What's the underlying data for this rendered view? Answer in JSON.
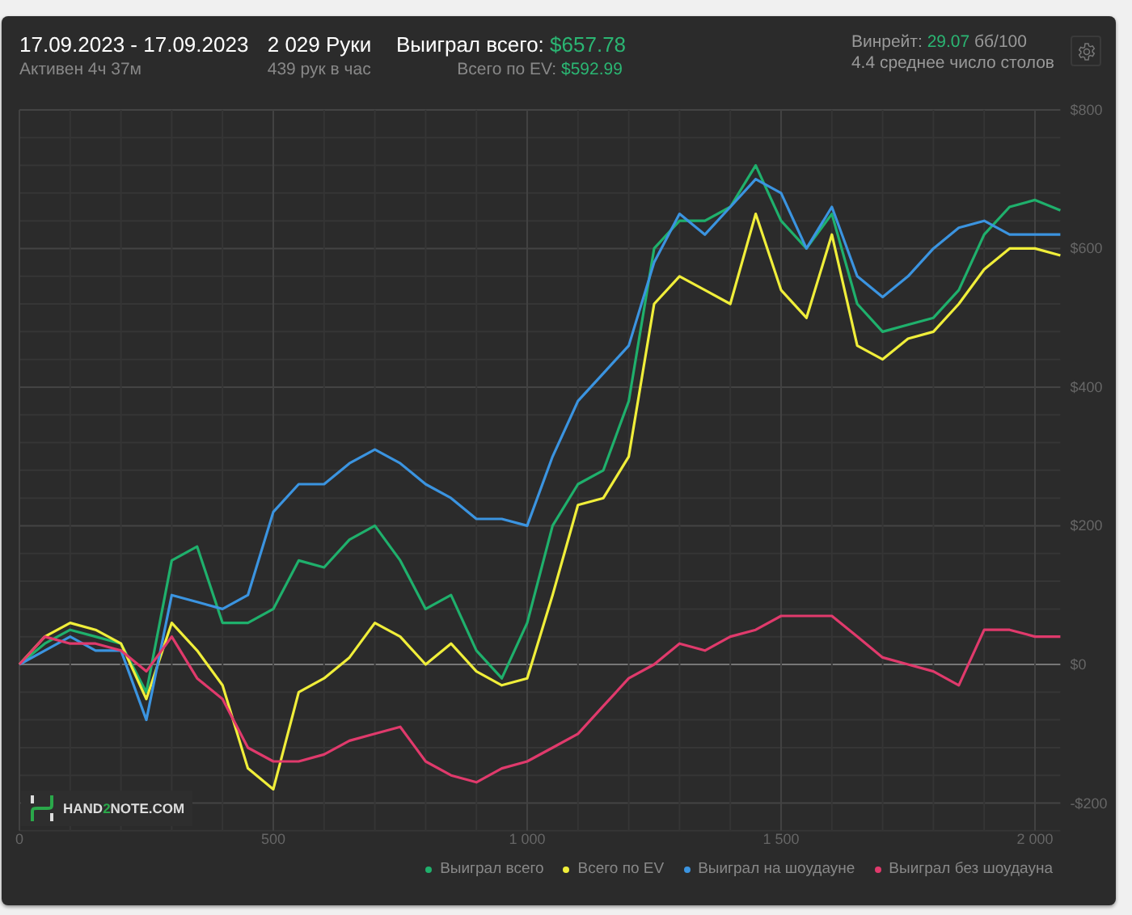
{
  "header": {
    "period": "17.09.2023 - 17.09.2023",
    "active": "Активен 4ч 37м",
    "hands": "2 029 Руки",
    "hands_rate": "439 рук в час",
    "won_label": "Выиграл всего:",
    "won_value": "$657.78",
    "ev_label": "Всего по EV:",
    "ev_value": "$592.99",
    "winrate_label": "Винрейт:",
    "winrate_value": "29.07",
    "winrate_unit": "бб/100",
    "tables": "4.4 среднее число столов"
  },
  "logo": {
    "prefix": "HAND",
    "mark": "2",
    "suffix": "NOTE.COM"
  },
  "chart_data": {
    "type": "line",
    "x": [
      0,
      50,
      100,
      150,
      200,
      250,
      300,
      350,
      400,
      450,
      500,
      550,
      600,
      650,
      700,
      750,
      800,
      850,
      900,
      950,
      1000,
      1050,
      1100,
      1150,
      1200,
      1250,
      1300,
      1350,
      1400,
      1450,
      1500,
      1550,
      1600,
      1650,
      1700,
      1750,
      1800,
      1850,
      1900,
      1950,
      2000,
      2050
    ],
    "xlim": [
      0,
      2050
    ],
    "ylim": [
      -240,
      800
    ],
    "grid": true,
    "xticks": [
      {
        "value": 0,
        "label": "0"
      },
      {
        "value": 500,
        "label": "500"
      },
      {
        "value": 1000,
        "label": "1 000"
      },
      {
        "value": 1500,
        "label": "1 500"
      },
      {
        "value": 2000,
        "label": "2 000"
      }
    ],
    "yticks": [
      {
        "value": 800,
        "label": "$800"
      },
      {
        "value": 600,
        "label": "$600"
      },
      {
        "value": 400,
        "label": "$400"
      },
      {
        "value": 200,
        "label": "$200"
      },
      {
        "value": 0,
        "label": "$0"
      },
      {
        "value": -200,
        "label": "-$200"
      }
    ],
    "series": [
      {
        "name": "Выиграл всего",
        "color": "#1fb06c",
        "values": [
          0,
          30,
          50,
          40,
          30,
          -40,
          150,
          170,
          60,
          60,
          80,
          150,
          140,
          180,
          200,
          150,
          80,
          100,
          20,
          -20,
          60,
          200,
          260,
          280,
          380,
          600,
          640,
          640,
          660,
          720,
          640,
          600,
          650,
          520,
          480,
          490,
          500,
          540,
          620,
          660,
          670,
          655
        ]
      },
      {
        "name": "Всего по EV",
        "color": "#f0ee3a",
        "values": [
          0,
          40,
          60,
          50,
          30,
          -50,
          60,
          20,
          -30,
          -150,
          -180,
          -40,
          -20,
          10,
          60,
          40,
          0,
          30,
          -10,
          -30,
          -20,
          100,
          230,
          240,
          300,
          520,
          560,
          540,
          520,
          650,
          540,
          500,
          620,
          460,
          440,
          470,
          480,
          520,
          570,
          600,
          600,
          590
        ]
      },
      {
        "name": "Выиграл на шоудауне",
        "color": "#3b94e0",
        "values": [
          0,
          20,
          40,
          20,
          20,
          -80,
          100,
          90,
          80,
          100,
          220,
          260,
          260,
          290,
          310,
          290,
          260,
          240,
          210,
          210,
          200,
          300,
          380,
          420,
          460,
          580,
          650,
          620,
          660,
          700,
          680,
          600,
          660,
          560,
          530,
          560,
          600,
          630,
          640,
          620,
          620,
          620
        ]
      },
      {
        "name": "Выиграл без шоудауна",
        "color": "#e03a6c",
        "values": [
          0,
          40,
          30,
          30,
          20,
          -10,
          40,
          -20,
          -50,
          -120,
          -140,
          -140,
          -130,
          -110,
          -100,
          -90,
          -140,
          -160,
          -170,
          -150,
          -140,
          -120,
          -100,
          -60,
          -20,
          0,
          30,
          20,
          40,
          50,
          70,
          70,
          70,
          40,
          10,
          0,
          -10,
          -30,
          50,
          50,
          40,
          40
        ]
      }
    ]
  }
}
